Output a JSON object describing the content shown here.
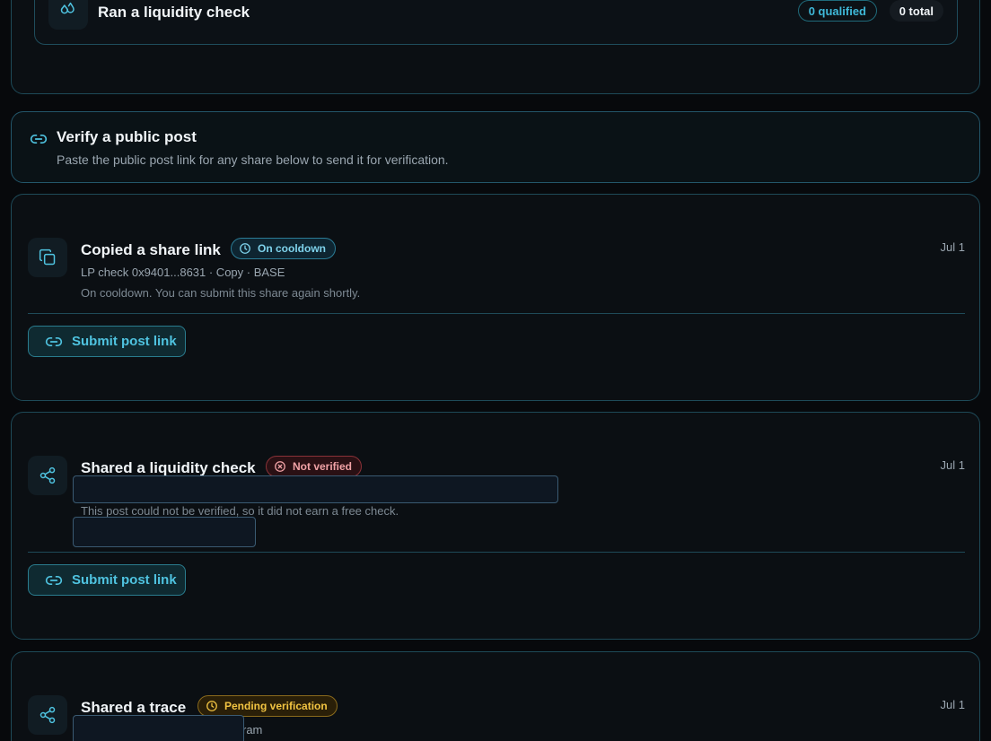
{
  "top_card": {
    "row_title": "Ran a liquidity check",
    "qualified": "0 qualified",
    "total": "0 total"
  },
  "verify": {
    "title": "Verify a public post",
    "subtitle": "Paste the public post link for any share below to send it for verification."
  },
  "activities": [
    {
      "title": "Copied a share link",
      "status": "On cooldown",
      "date": "Jul 1",
      "meta": "LP check 0x9401...8631 · Copy · BASE",
      "note": "On cooldown. You can submit this share again shortly.",
      "button": "Submit post link"
    },
    {
      "title": "Shared a liquidity check",
      "status": "Not verified",
      "date": "Jul 1",
      "note": "This post could not be verified, so it did not earn a free check.",
      "button": "Submit post link"
    },
    {
      "title": "Shared a trace",
      "status": "Pending verification",
      "date": "Jul 1",
      "meta_fragment": "ram"
    }
  ],
  "colors": {
    "accent": "#3fb8d8",
    "border": "#1e4a58",
    "danger": "#f1a2a6",
    "warning": "#f2c442"
  }
}
